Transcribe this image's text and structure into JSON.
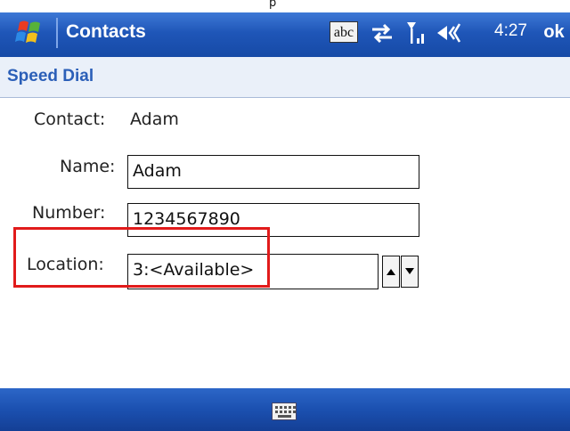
{
  "top_strip": {
    "label": "p"
  },
  "titlebar": {
    "app_title": "Contacts",
    "input_mode": "abc",
    "time": "4:27",
    "ok_label": "ok"
  },
  "subtitle": "Speed Dial",
  "form": {
    "contact_label": "Contact:",
    "contact_value": "Adam",
    "name_label": "Name:",
    "name_value": "Adam",
    "number_label": "Number:",
    "number_value": "1234567890",
    "location_label": "Location:",
    "location_value": "3:<Available>"
  },
  "colors": {
    "titlebar": "#1f56b8",
    "subtitle_text": "#2b5fb8",
    "highlight": "#e11b1b"
  },
  "icons": [
    "windows-start-icon",
    "connectivity-icon",
    "signal-icon",
    "volume-icon",
    "keyboard-icon",
    "spin-up-icon",
    "spin-down-icon"
  ]
}
